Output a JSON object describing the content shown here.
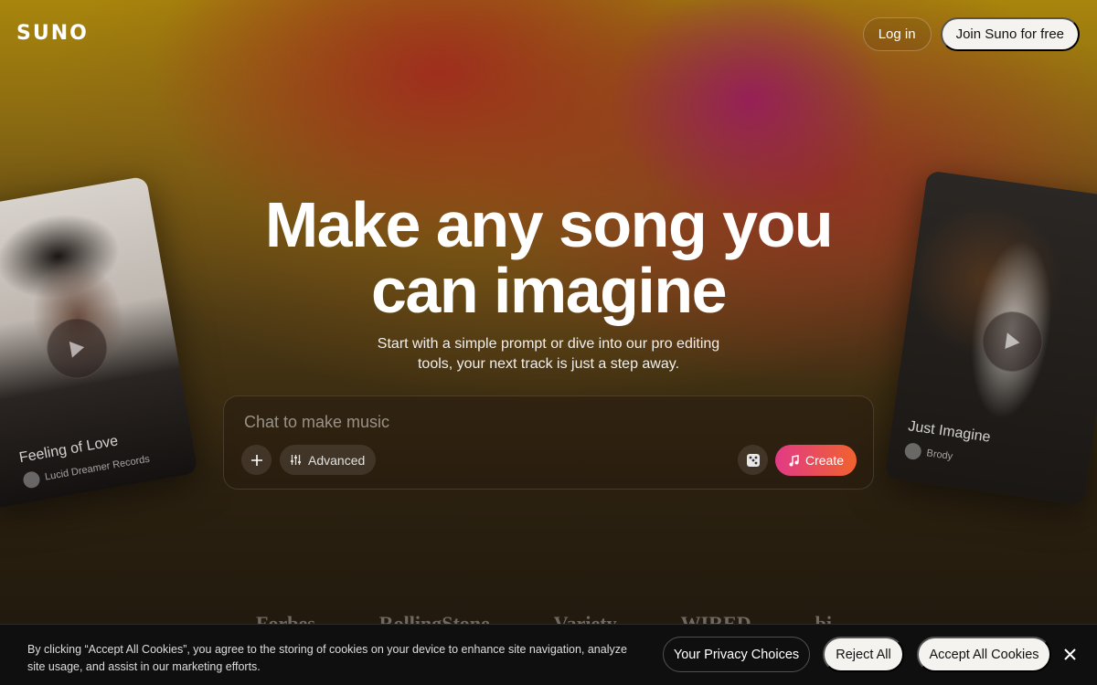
{
  "header": {
    "logo": "SUNO",
    "login_label": "Log in",
    "join_label": "Join Suno for free"
  },
  "hero": {
    "title_line1": "Make any song you",
    "title_line2": "can imagine",
    "subtitle_line1": "Start with a simple prompt or dive into our pro editing",
    "subtitle_line2": "tools, your next track is just a step away."
  },
  "chat": {
    "placeholder": "Chat to make music",
    "advanced_label": "Advanced",
    "create_label": "Create",
    "create_gradient": [
      "#e23a86",
      "#f0622e"
    ]
  },
  "cards": [
    {
      "title": "Feeling of Love",
      "artist": "Lucid Dreamer Records"
    },
    {
      "title": "Just Imagine",
      "artist": "Brody"
    }
  ],
  "press": [
    "Forbes",
    "RollingStone",
    "Variety",
    "WIRED",
    "bi"
  ],
  "cookie": {
    "text": "By clicking “Accept All Cookies”, you agree to the storing of cookies on your device to enhance site navigation, analyze site usage, and assist in our marketing efforts.",
    "privacy_label": "Your Privacy Choices",
    "reject_label": "Reject All",
    "accept_label": "Accept All Cookies"
  }
}
